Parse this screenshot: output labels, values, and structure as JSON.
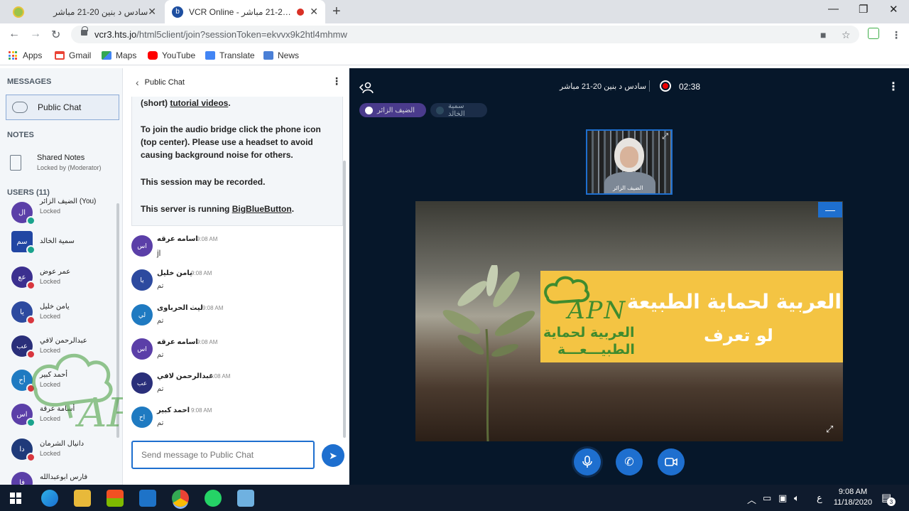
{
  "browser": {
    "tabs": [
      {
        "title": "سادس د بنين 20-21 مباشر",
        "active": false
      },
      {
        "title": "VCR Online - بنين 20-21 مباشر",
        "active": true
      }
    ],
    "url_host": "vcr3.hts.jo",
    "url_path": "/html5client/join?sessionToken=ekvvx9k2htl4mhmw",
    "bookmarks": [
      "Apps",
      "Gmail",
      "Maps",
      "YouTube",
      "Translate",
      "News"
    ]
  },
  "sidebar": {
    "messages_header": "MESSAGES",
    "public_chat_label": "Public Chat",
    "notes_header": "NOTES",
    "shared_notes_label": "Shared Notes",
    "shared_notes_sub": "Locked by (Moderator)",
    "users_header": "USERS (11)",
    "users": [
      {
        "initials": "ال",
        "name": "الضيف الزائر (You)",
        "status": "Locked",
        "color": "#5b3fa8",
        "badge": "#1aa38d"
      },
      {
        "initials": "سم",
        "name": "سمية الخالد",
        "status": "",
        "color": "#2146a3",
        "badge": "#1aa38d"
      },
      {
        "initials": "عع",
        "name": "عمر عوض",
        "status": "Locked",
        "color": "#3b2f8f",
        "badge": "#d9363e"
      },
      {
        "initials": "يا",
        "name": "يامن خليل",
        "status": "Locked",
        "color": "#2d4a9f",
        "badge": "#d9363e"
      },
      {
        "initials": "عب",
        "name": "عبدالرحمن لافي",
        "status": "Locked",
        "color": "#2a2f7a",
        "badge": "#d9363e"
      },
      {
        "initials": "أح",
        "name": "أحمد كبير",
        "status": "Locked",
        "color": "#1f7ac1",
        "badge": "#d9363e"
      },
      {
        "initials": "اس",
        "name": "أسامة عرقة",
        "status": "Locked",
        "color": "#5b3fa8",
        "badge": "#1aa38d"
      },
      {
        "initials": "دا",
        "name": "دانيال الشرمان",
        "status": "Locked",
        "color": "#1f3a7a",
        "badge": "#d9363e"
      },
      {
        "initials": "فا",
        "name": "فارس ابوعبدالله",
        "status": "",
        "color": "#5b3fa8",
        "badge": "#d9363e"
      }
    ]
  },
  "chat": {
    "header": "Public Chat",
    "welcome": {
      "line1_prefix": "(short) ",
      "line1_link": "tutorial videos",
      "line1_suffix": ".",
      "audio": "To join the audio bridge click the phone icon (top center). Please use a headset to avoid causing background noise for others.",
      "recorded": "This session may be recorded.",
      "server_prefix": "This server is running ",
      "server_link": "BigBlueButton",
      "server_suffix": "."
    },
    "messages": [
      {
        "initials": "اس",
        "name": "اسامه عرقه",
        "time": "9:08 AM",
        "text": "jl",
        "color": "#5b3fa8"
      },
      {
        "initials": "يا",
        "name": "يامن خليل",
        "time": "9:08 AM",
        "text": "تم",
        "color": "#2d4a9f"
      },
      {
        "initials": "لي",
        "name": "ليث الحرباوى",
        "time": "9:08 AM",
        "text": "تم",
        "color": "#1f7ac1"
      },
      {
        "initials": "اس",
        "name": "اسامه عرقه",
        "time": "9:08 AM",
        "text": "تم",
        "color": "#5b3fa8"
      },
      {
        "initials": "عب",
        "name": "عبدالرحمن لافي",
        "time": "9:08 AM",
        "text": "تم",
        "color": "#2a2f7a"
      },
      {
        "initials": "اح",
        "name": "احمد كبير",
        "time": "9:08 AM",
        "text": "تم",
        "color": "#1f7ac1"
      }
    ],
    "input_placeholder": "Send message to Public Chat"
  },
  "session": {
    "title": "سادس د بنين 20-21 مباشر",
    "recording_time": "02:38",
    "talkers": [
      {
        "name": "الضيف الزائر",
        "active": true
      },
      {
        "name": "سمية الخالد",
        "active": false
      }
    ],
    "webcam_label": "الضيف الزائر",
    "slide": {
      "title_line1": "العربية لحماية الطبيعة",
      "title_line2": "لو تعرف",
      "logo_text": "APN",
      "logo_ar1": "العربية لحماية",
      "logo_ar2": "الطبيـــعـــة"
    }
  },
  "watermark_text": "APN",
  "taskbar": {
    "tray_lang": "ع",
    "time": "9:08 AM",
    "date": "11/18/2020",
    "notifications": "3"
  },
  "colors": {
    "accent": "#1e6fcf",
    "main_bg": "#06172a",
    "recording": "#e00000"
  }
}
